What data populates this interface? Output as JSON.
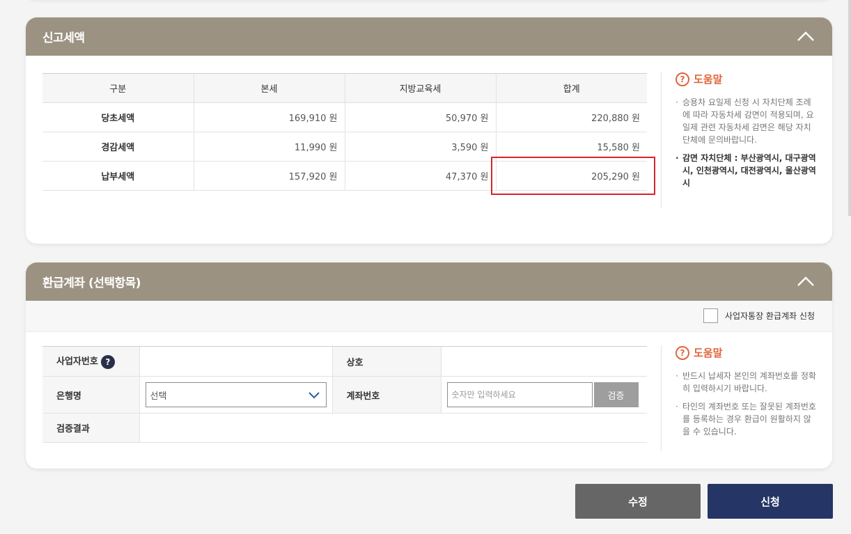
{
  "tax_section": {
    "title": "신고세액",
    "columns": [
      "구분",
      "본세",
      "지방교육세",
      "합계"
    ],
    "rows": [
      {
        "label": "당초세액",
        "base": "169,910 원",
        "edu": "50,970 원",
        "total": "220,880 원"
      },
      {
        "label": "경감세액",
        "base": "11,990 원",
        "edu": "3,590 원",
        "total": "15,580 원"
      },
      {
        "label": "납부세액",
        "base": "157,920 원",
        "edu": "47,370 원",
        "total": "205,290 원"
      }
    ],
    "highlight_color": "#d8232a"
  },
  "help_1": {
    "title": "도움말",
    "items": [
      "승용차 요일제 신청 시 자치단체 조례에 따라 자동차세 감면이 적용되며, 요일제 관련 자동차세 감면은 해당 자치단체에 문의바랍니다.",
      "감면 자치단체 : 부산광역시, 대구광역시, 인천광역시, 대전광역시, 울산광역시"
    ]
  },
  "refund_section": {
    "title": "환급계좌 (선택항목)",
    "checkbox_label": "사업자통장 환급계좌 신청",
    "biz_no_label": "사업자번호",
    "company_label": "상호",
    "bank_label": "은행명",
    "bank_selected": "선택",
    "account_label": "계좌번호",
    "account_placeholder": "숫자만 입력하세요",
    "verify_label": "검증",
    "result_label": "검증결과"
  },
  "help_2": {
    "title": "도움말",
    "items": [
      "반드시 납세자 본인의 계좌번호를 정확히 입력하시기 바랍니다.",
      "타인의 계좌번호 또는 잘못된 계좌번호를 등록하는 경우 환급이 원활하지 않을 수 있습니다."
    ]
  },
  "actions": {
    "edit_label": "수정",
    "apply_label": "신청"
  },
  "colors": {
    "header_bg": "#9c9282",
    "help_accent": "#e0643a",
    "apply_btn": "#253565",
    "edit_btn": "#666666"
  },
  "icons": {
    "collapse": "chevron-up-icon",
    "help": "question-circle-icon",
    "dropdown": "chevron-down-icon"
  }
}
